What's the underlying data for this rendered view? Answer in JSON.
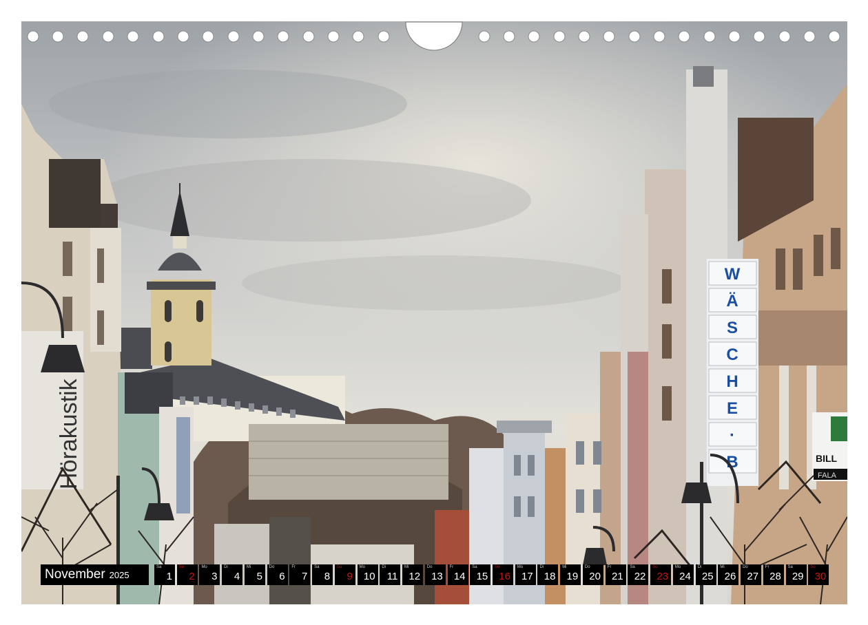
{
  "calendar": {
    "month": "November",
    "year": "2025",
    "days": [
      {
        "wd": "Sa",
        "n": "1",
        "sun": false
      },
      {
        "wd": "So",
        "n": "2",
        "sun": true
      },
      {
        "wd": "Mo",
        "n": "3",
        "sun": false
      },
      {
        "wd": "Di",
        "n": "4",
        "sun": false
      },
      {
        "wd": "Mi",
        "n": "5",
        "sun": false
      },
      {
        "wd": "Do",
        "n": "6",
        "sun": false
      },
      {
        "wd": "Fr",
        "n": "7",
        "sun": false
      },
      {
        "wd": "Sa",
        "n": "8",
        "sun": false
      },
      {
        "wd": "So",
        "n": "9",
        "sun": true
      },
      {
        "wd": "Mo",
        "n": "10",
        "sun": false
      },
      {
        "wd": "Di",
        "n": "11",
        "sun": false
      },
      {
        "wd": "Mi",
        "n": "12",
        "sun": false
      },
      {
        "wd": "Do",
        "n": "13",
        "sun": false
      },
      {
        "wd": "Fr",
        "n": "14",
        "sun": false
      },
      {
        "wd": "Sa",
        "n": "15",
        "sun": false
      },
      {
        "wd": "So",
        "n": "16",
        "sun": true
      },
      {
        "wd": "Mo",
        "n": "17",
        "sun": false
      },
      {
        "wd": "Di",
        "n": "18",
        "sun": false
      },
      {
        "wd": "Mi",
        "n": "19",
        "sun": false
      },
      {
        "wd": "Do",
        "n": "20",
        "sun": false
      },
      {
        "wd": "Fr",
        "n": "21",
        "sun": false
      },
      {
        "wd": "Sa",
        "n": "22",
        "sun": false
      },
      {
        "wd": "So",
        "n": "23",
        "sun": true
      },
      {
        "wd": "Mo",
        "n": "24",
        "sun": false
      },
      {
        "wd": "Di",
        "n": "25",
        "sun": false
      },
      {
        "wd": "Mi",
        "n": "26",
        "sun": false
      },
      {
        "wd": "Do",
        "n": "27",
        "sun": false
      },
      {
        "wd": "Fr",
        "n": "28",
        "sun": false
      },
      {
        "wd": "Sa",
        "n": "29",
        "sun": false
      },
      {
        "wd": "So",
        "n": "30",
        "sun": true
      }
    ]
  },
  "photo": {
    "sign_letters": [
      "W",
      "Ä",
      "S",
      "C",
      "H",
      "E",
      "·",
      "B"
    ],
    "shop_sign_1": "Hörakustik",
    "shop_sign_2": "BILL",
    "shop_sign_3": "FALA"
  },
  "colors": {
    "sky_top": "#a8acb0",
    "sky_bottom": "#e4e2dc",
    "sunday": "#c01818",
    "sign_blue": "#1a4fa0"
  }
}
